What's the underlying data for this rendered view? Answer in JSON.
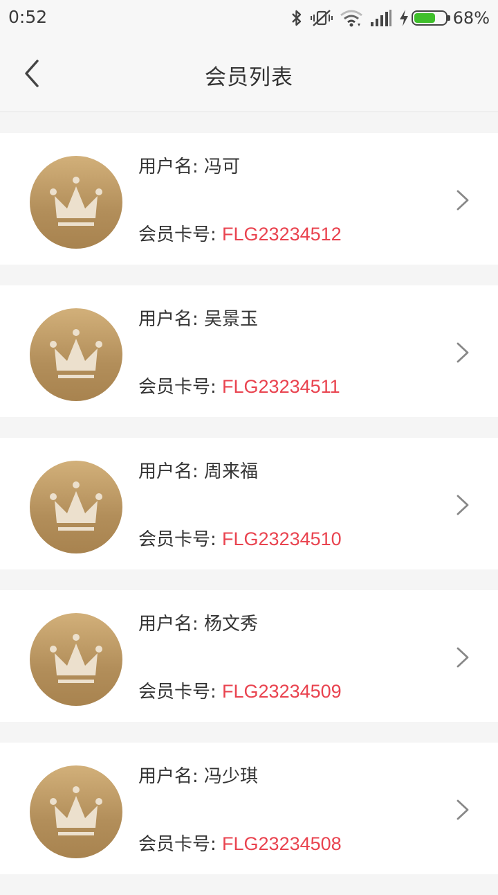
{
  "status": {
    "time": "0:52",
    "battery_text": "68%",
    "battery_level": 0.68,
    "icons": [
      "bluetooth-icon",
      "vibrate-off-icon",
      "wifi-icon",
      "signal-icon",
      "charging-icon",
      "battery-icon"
    ]
  },
  "nav": {
    "title": "会员列表",
    "back_icon": "chevron-left-icon"
  },
  "labels": {
    "username": "用户名:",
    "card": "会员卡号:"
  },
  "members": [
    {
      "name": "冯可",
      "card": "FLG23234512"
    },
    {
      "name": "吴景玉",
      "card": "FLG23234511"
    },
    {
      "name": "周来福",
      "card": "FLG23234510"
    },
    {
      "name": "杨文秀",
      "card": "FLG23234509"
    },
    {
      "name": "冯少琪",
      "card": "FLG23234508"
    }
  ],
  "colors": {
    "accent_red": "#e9434f",
    "avatar_gold": "#b8945f",
    "battery_green": "#3fbf2b"
  }
}
